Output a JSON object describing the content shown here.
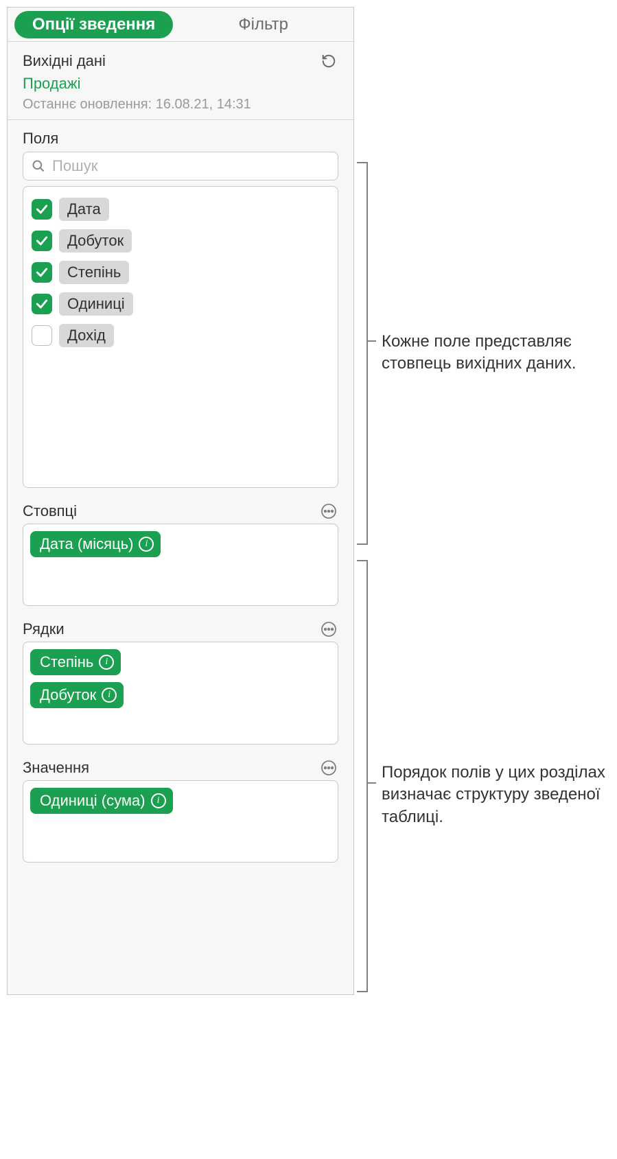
{
  "tabs": {
    "active_label": "Опції зведення",
    "inactive_label": "Фільтр"
  },
  "source": {
    "title": "Вихідні дані",
    "name": "Продажі",
    "updated_label": "Останнє оновлення: 16.08.21, 14:31"
  },
  "fields": {
    "label": "Поля",
    "search_placeholder": "Пошук",
    "items": [
      {
        "label": "Дата",
        "checked": true
      },
      {
        "label": "Добуток",
        "checked": true
      },
      {
        "label": "Степінь",
        "checked": true
      },
      {
        "label": "Одиниці",
        "checked": true
      },
      {
        "label": "Дохід",
        "checked": false
      }
    ]
  },
  "columns": {
    "label": "Стовпці",
    "items": [
      {
        "label": "Дата (місяць)"
      }
    ]
  },
  "rows": {
    "label": "Рядки",
    "items": [
      {
        "label": "Степінь"
      },
      {
        "label": "Добуток"
      }
    ]
  },
  "values": {
    "label": "Значення",
    "items": [
      {
        "label": "Одиниці (сума)"
      }
    ]
  },
  "callouts": {
    "a": "Кожне поле представляє стовпець вихідних даних.",
    "b": "Порядок полів у цих розділах визначає структуру зведеної таблиці."
  }
}
